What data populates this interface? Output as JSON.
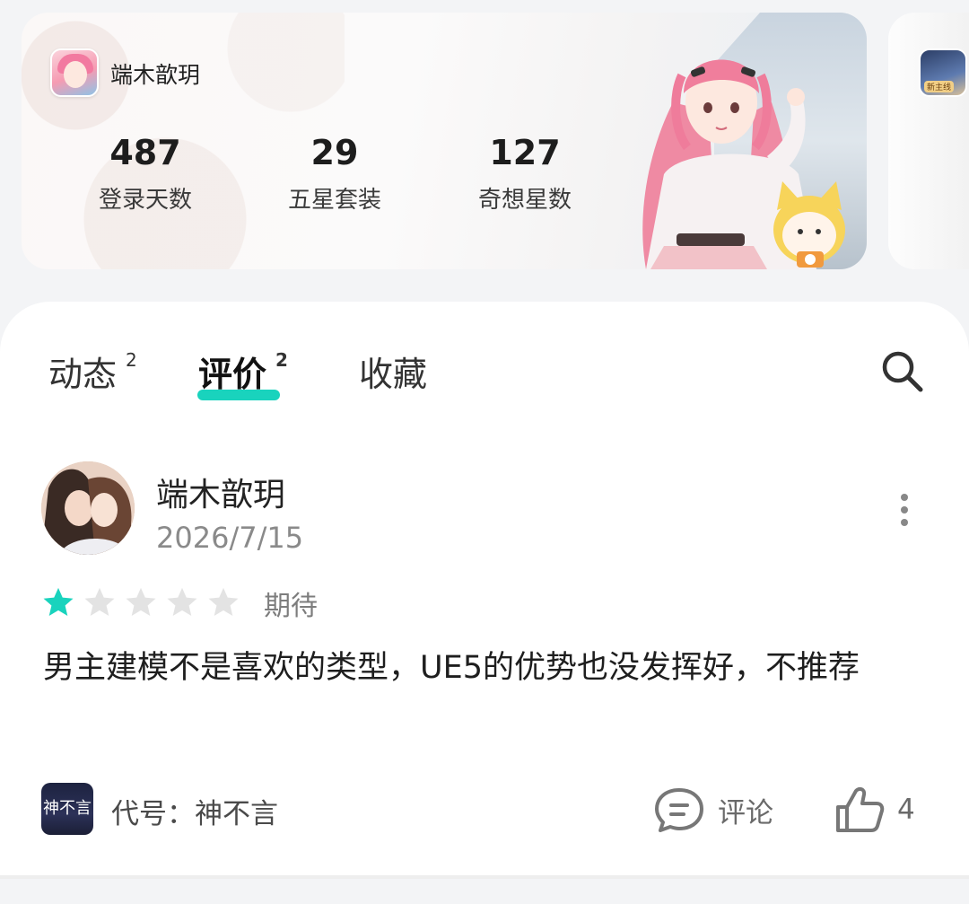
{
  "game_card": {
    "game_name": "端木歆玥",
    "stats": [
      {
        "value": "487",
        "label": "登录天数"
      },
      {
        "value": "29",
        "label": "五星套装"
      },
      {
        "value": "127",
        "label": "奇想星数"
      }
    ],
    "next_card_badge": "新主线"
  },
  "tabs": [
    {
      "label": "动态",
      "count": "2"
    },
    {
      "label": "评价",
      "count": "2"
    },
    {
      "label": "收藏",
      "count": ""
    }
  ],
  "active_tab": "评价",
  "review": {
    "user_name": "端木歆玥",
    "date": "2026/7/15",
    "rating": 1,
    "rating_max": 5,
    "rating_label": "期待",
    "text": "男主建模不是喜欢的类型，UE5的优势也没发挥好，不推荐",
    "game_tag": {
      "icon_text": "神不言",
      "name": "代号：神不言"
    },
    "comment_label": "评论",
    "like_count": "4"
  },
  "colors": {
    "accent": "#19d3bd",
    "star_active": "#19d3bd",
    "star_inactive": "#e3e3e3",
    "background": "#f3f4f6"
  },
  "icons": {
    "search": "search-icon",
    "more": "more-vertical-icon",
    "comment": "comment-bubble-icon",
    "like": "thumbs-up-icon",
    "star": "star-icon"
  }
}
